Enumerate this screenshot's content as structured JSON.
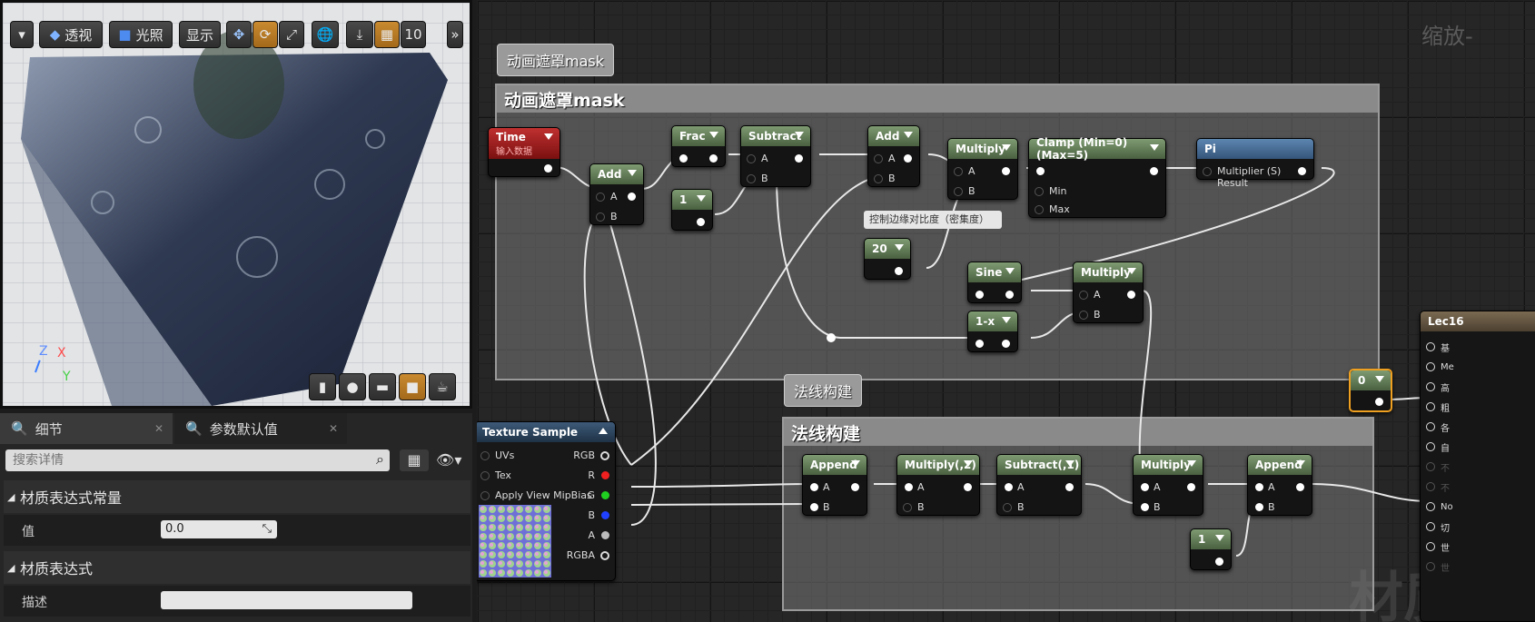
{
  "viewport": {
    "toolbar": {
      "perspective": "透视",
      "lit": "光照",
      "show": "显示",
      "grid_size": "10"
    },
    "axis": {
      "z": "Z",
      "x": "X",
      "y": "Y"
    }
  },
  "details": {
    "tabs": [
      {
        "label": "细节"
      },
      {
        "label": "参数默认值"
      }
    ],
    "search_placeholder": "搜索详情",
    "sections": [
      {
        "title": "材质表达式常量",
        "rows": [
          {
            "label": "值",
            "value": "0.0"
          }
        ]
      },
      {
        "title": "材质表达式",
        "rows": [
          {
            "label": "描述",
            "value": ""
          }
        ]
      }
    ]
  },
  "graph": {
    "zoom_label": "缩放-",
    "watermark": "材质",
    "comments": {
      "anim_mask": {
        "title": "动画遮罩mask",
        "bubble": "动画遮罩mask"
      },
      "normal": {
        "title": "法线构建",
        "bubble": "法线构建"
      }
    },
    "nodes": {
      "time": {
        "title": "Time",
        "subtitle": "输入数据"
      },
      "add1": {
        "title": "Add",
        "a": "A",
        "b": "B"
      },
      "frac": {
        "title": "Frac"
      },
      "const1": {
        "title": "1"
      },
      "subtract": {
        "title": "Subtract",
        "a": "A",
        "b": "B"
      },
      "add2": {
        "title": "Add",
        "a": "A",
        "b": "B"
      },
      "multiply1": {
        "title": "Multiply",
        "a": "A",
        "b": "B"
      },
      "clamp": {
        "title": "Clamp (Min=0) (Max=5)",
        "min": "Min",
        "max": "Max"
      },
      "pi": {
        "title": "Pi",
        "pin": "Multiplier (S) Result"
      },
      "note": {
        "text": "控制边缘对比度（密集度）"
      },
      "const20": {
        "title": "20"
      },
      "sine": {
        "title": "Sine"
      },
      "one_minus": {
        "title": "1-x"
      },
      "multiply2": {
        "title": "Multiply",
        "a": "A",
        "b": "B"
      },
      "texture": {
        "title": "Texture Sample",
        "inputs": [
          "UVs",
          "Tex",
          "Apply View MipBias"
        ],
        "outputs": [
          "RGB",
          "R",
          "G",
          "B",
          "A",
          "RGBA"
        ]
      },
      "append1": {
        "title": "Append",
        "a": "A",
        "b": "B"
      },
      "multiply_2": {
        "title": "Multiply(,2)",
        "a": "A",
        "b": "B"
      },
      "subtract_1": {
        "title": "Subtract(,1)",
        "a": "A",
        "b": "B"
      },
      "multiply3": {
        "title": "Multiply",
        "a": "A",
        "b": "B"
      },
      "append2": {
        "title": "Append",
        "a": "A",
        "b": "B"
      },
      "const1b": {
        "title": "1"
      },
      "const0": {
        "title": "0"
      },
      "result": {
        "title": "Lec16",
        "pins": [
          "基",
          "Me",
          "高",
          "粗",
          "各",
          "自",
          "不",
          "不",
          "No",
          "切",
          "世",
          "世"
        ]
      }
    }
  },
  "colors": {
    "accent": "#c98a2f",
    "node_header": "#5f7a54",
    "selected": "#f0a020"
  }
}
